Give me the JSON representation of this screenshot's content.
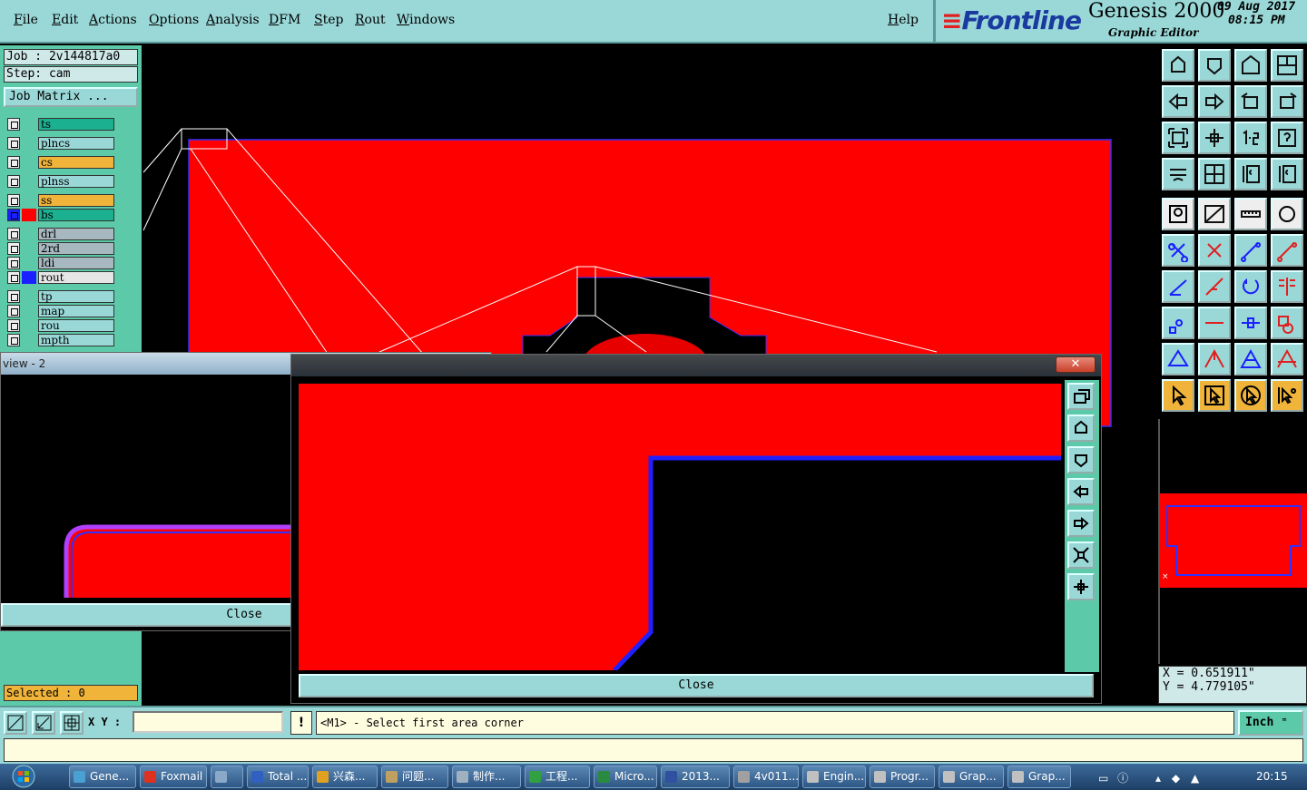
{
  "menu": [
    "File",
    "Edit",
    "Actions",
    "Options",
    "Analysis",
    "DFM",
    "Step",
    "Rout",
    "Windows"
  ],
  "help": "Help",
  "brand": {
    "logo": "Frontline",
    "product": "Genesis 2000",
    "subtitle": "Graphic Editor",
    "date": "09 Aug 2017",
    "time": "08:15 PM"
  },
  "job": {
    "job_line": "Job : 2v144817a0",
    "step_line": "Step: cam",
    "job_matrix": "Job Matrix ..."
  },
  "layers": [
    {
      "name": "ts",
      "bg": "#1ab090",
      "swatch": ""
    },
    {
      "name": "plncs",
      "bg": "#9ad8d8",
      "swatch": ""
    },
    {
      "name": "cs",
      "bg": "#f0b43a",
      "swatch": ""
    },
    {
      "name": "plnss",
      "bg": "#9ad8d8",
      "swatch": ""
    },
    {
      "name": "ss",
      "bg": "#f0b43a",
      "swatch": ""
    },
    {
      "name": "bs",
      "bg": "#1ab090",
      "swatch": "#ff0000"
    },
    {
      "name": "drl",
      "bg": "#a8b8c0",
      "swatch": ""
    },
    {
      "name": "2rd",
      "bg": "#a8b8c0",
      "swatch": ""
    },
    {
      "name": "ldi",
      "bg": "#a8b8c0",
      "swatch": ""
    },
    {
      "name": "rout",
      "bg": "#e6e6e6",
      "swatch": "#1a20ff"
    },
    {
      "name": "tp",
      "bg": "#9ad8d8",
      "swatch": ""
    },
    {
      "name": "map",
      "bg": "#9ad8d8",
      "swatch": ""
    },
    {
      "name": "rou",
      "bg": "#9ad8d8",
      "swatch": ""
    },
    {
      "name": "mpth",
      "bg": "#9ad8d8",
      "swatch": ""
    }
  ],
  "selected": "Selected : 0",
  "coords": {
    "x": "X = 0.651911\"",
    "y": "Y = 4.779105\""
  },
  "cmd": {
    "xy_label": "X Y :",
    "xy_value": "",
    "message": "<M1> - Select first area corner",
    "unit": "Inch"
  },
  "popup_left": {
    "title": "view - 2",
    "close": "Close"
  },
  "popup_right": {
    "title": "",
    "close": "Close"
  },
  "taskbar": {
    "tasks": [
      {
        "label": "Gene...",
        "color": "#4aa0d0"
      },
      {
        "label": "Foxmail",
        "color": "#e03020"
      },
      {
        "label": "",
        "color": "#8aa8c8"
      },
      {
        "label": "Total ...",
        "color": "#3060c0"
      },
      {
        "label": "兴森...",
        "color": "#e0a020"
      },
      {
        "label": "问题...",
        "color": "#c0a060"
      },
      {
        "label": "制作...",
        "color": "#a0b0c0"
      },
      {
        "label": "工程...",
        "color": "#30a040"
      },
      {
        "label": "Micro...",
        "color": "#2a8a40"
      },
      {
        "label": "2013...",
        "color": "#3050a0"
      },
      {
        "label": "4v011...",
        "color": "#a0a0a0"
      },
      {
        "label": "Engin...",
        "color": "#c0c0c0"
      },
      {
        "label": "Progr...",
        "color": "#c0c0c0"
      },
      {
        "label": "Grap...",
        "color": "#c0c0c0"
      },
      {
        "label": "Grap...",
        "color": "#c0c0c0"
      }
    ],
    "clock": "20:15"
  },
  "colors": {
    "teal": "#9ad8d8",
    "green": "#5ccaa8",
    "red": "#ff0000",
    "blue": "#1a20ff",
    "orange": "#f0b43a"
  }
}
